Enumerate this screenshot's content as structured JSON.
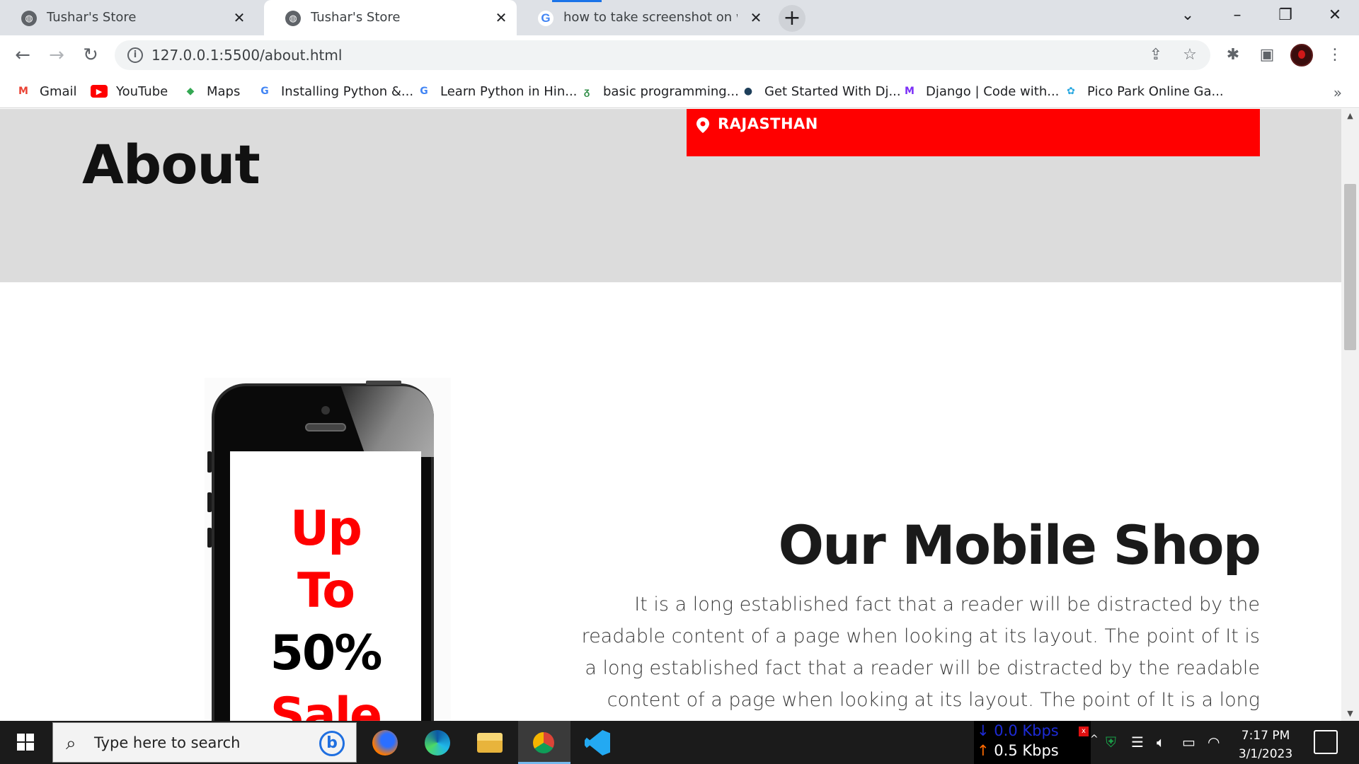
{
  "browser": {
    "tabs": [
      {
        "title": "Tushar's Store",
        "icon": "globe-icon",
        "active": false
      },
      {
        "title": "Tushar's Store",
        "icon": "globe-icon",
        "active": true
      },
      {
        "title": "how to take screenshot on windo",
        "icon": "google-icon",
        "active": false
      }
    ],
    "close_glyph": "✕",
    "new_tab_glyph": "+",
    "url": "127.0.0.1:5500/about.html",
    "bookmarks": [
      {
        "label": "Gmail",
        "icon": "gmail-icon",
        "color": "#ea4335",
        "glyph": "M"
      },
      {
        "label": "YouTube",
        "icon": "youtube-icon",
        "color": "#ff0000",
        "glyph": "▶"
      },
      {
        "label": "Maps",
        "icon": "maps-icon",
        "color": "#34a853",
        "glyph": "◆"
      },
      {
        "label": "Installing Python &...",
        "icon": "google-icon",
        "color": "#4285f4",
        "glyph": "G"
      },
      {
        "label": "Learn Python in Hin...",
        "icon": "google-icon",
        "color": "#4285f4",
        "glyph": "G"
      },
      {
        "label": "basic programming...",
        "icon": "geeksforgeeks-icon",
        "color": "#2f8d46",
        "glyph": "ᵹ"
      },
      {
        "label": "Get Started With Dj...",
        "icon": "python-icon",
        "color": "#1e3f5a",
        "glyph": "●"
      },
      {
        "label": "Django | Code with...",
        "icon": "codewithharry-icon",
        "color": "#7b2ff7",
        "glyph": "M"
      },
      {
        "label": "Pico Park Online Ga...",
        "icon": "pico-park-icon",
        "color": "#2aa8e0",
        "glyph": "✿"
      }
    ],
    "bookmarks_more": "»"
  },
  "page": {
    "hero_title": "About",
    "location": "RAJASTHAN",
    "promo": {
      "line1": "Up",
      "line2": "To",
      "line3": "50%",
      "line4": "Sale"
    },
    "shop_title": "Our Mobile Shop",
    "shop_text": "It is a long established fact that a reader will be distracted by the readable content of a page when looking at its layout. The point of It is a long established fact that a reader will be distracted by the readable content of a page when looking at its layout. The point of It is a long established fact",
    "colors": {
      "accent_red": "#ff0000",
      "hero_bg": "#dcdcdc"
    }
  },
  "taskbar": {
    "search_placeholder": "Type here to search",
    "net_down": "0.0 Kbps",
    "net_up": "0.5 Kbps",
    "time": "7:17 PM",
    "date": "3/1/2023",
    "apps": [
      "firefox-icon",
      "edge-icon",
      "file-explorer-icon",
      "chrome-icon",
      "vscode-icon"
    ]
  }
}
